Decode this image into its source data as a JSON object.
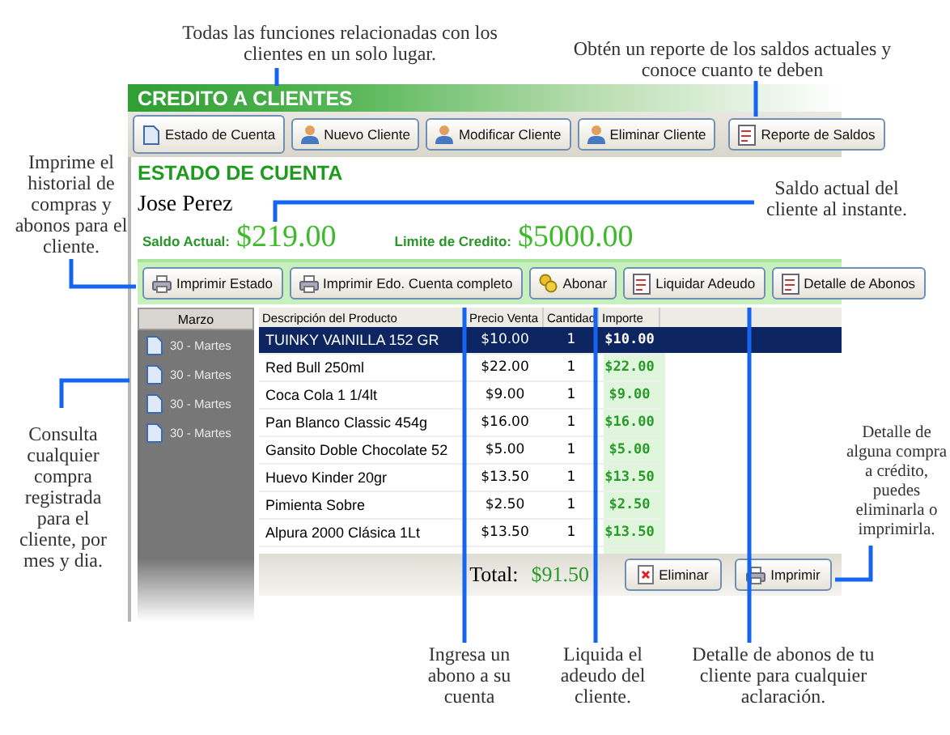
{
  "window": {
    "title": "CREDITO A CLIENTES"
  },
  "toolbar": [
    {
      "label": "Estado de Cuenta"
    },
    {
      "label": "Nuevo Cliente"
    },
    {
      "label": "Modificar Cliente"
    },
    {
      "label": "Eliminar Cliente"
    },
    {
      "label": "Reporte de Saldos"
    }
  ],
  "panel": {
    "heading": "ESTADO DE CUENTA",
    "client_name": "Jose Perez",
    "balance_label": "Saldo Actual:",
    "balance": "$219.00",
    "limit_label": "Limite de Credito:",
    "limit": "$5000.00"
  },
  "actions": [
    {
      "label": "Imprimir Estado"
    },
    {
      "label": "Imprimir Edo. Cuenta completo"
    },
    {
      "label": "Abonar"
    },
    {
      "label": "Liquidar Adeudo"
    },
    {
      "label": "Detalle de Abonos"
    }
  ],
  "sidebar": {
    "header": "Marzo",
    "items": [
      {
        "label": "30 - Martes"
      },
      {
        "label": "30 - Martes"
      },
      {
        "label": "30 - Martes"
      },
      {
        "label": "30 - Martes"
      }
    ]
  },
  "table": {
    "columns": [
      "Descripción del Producto",
      "Precio Venta",
      "Cantidad",
      "Importe"
    ],
    "rows": [
      {
        "cells": [
          "TUINKY VAINILLA 152 GR",
          "$10.00",
          "1",
          "$10.00"
        ],
        "selected": true
      },
      {
        "cells": [
          "Red Bull 250ml",
          "$22.00",
          "1",
          "$22.00"
        ],
        "selected": false
      },
      {
        "cells": [
          "Coca Cola 1 1/4lt",
          "$9.00",
          "1",
          "$9.00"
        ],
        "selected": false
      },
      {
        "cells": [
          "Pan Blanco Classic 454g",
          "$16.00",
          "1",
          "$16.00"
        ],
        "selected": false
      },
      {
        "cells": [
          "Gansito Doble Chocolate 52",
          "$5.00",
          "1",
          "$5.00"
        ],
        "selected": false
      },
      {
        "cells": [
          "Huevo Kinder 20gr",
          "$13.50",
          "1",
          "$13.50"
        ],
        "selected": false
      },
      {
        "cells": [
          "Pimienta Sobre",
          "$2.50",
          "1",
          "$2.50"
        ],
        "selected": false
      },
      {
        "cells": [
          "Alpura 2000 Clásica 1Lt",
          "$13.50",
          "1",
          "$13.50"
        ],
        "selected": false
      }
    ]
  },
  "footer": {
    "total_label": "Total:",
    "total": "$91.50",
    "buttons": [
      {
        "label": "Eliminar"
      },
      {
        "label": "Imprimir"
      }
    ]
  },
  "callouts": [
    {
      "text": "Todas las funciones relacionadas con los clientes en un solo lugar."
    },
    {
      "text": "Obtén un reporte de los saldos actuales y conoce cuanto te deben"
    },
    {
      "text": "Imprime el historial de compras y abonos para el cliente."
    },
    {
      "text": "Saldo actual del cliente al instante."
    },
    {
      "text": "Consulta cualquier compra registrada para el cliente, por mes y dia."
    },
    {
      "text": "Detalle de alguna compra a crédito, puedes eliminarla o imprimirla."
    },
    {
      "text": "Ingresa un abono  a su cuenta"
    },
    {
      "text": "Liquida el adeudo del cliente."
    },
    {
      "text": "Detalle de abonos de tu cliente para cualquier aclaración."
    }
  ]
}
